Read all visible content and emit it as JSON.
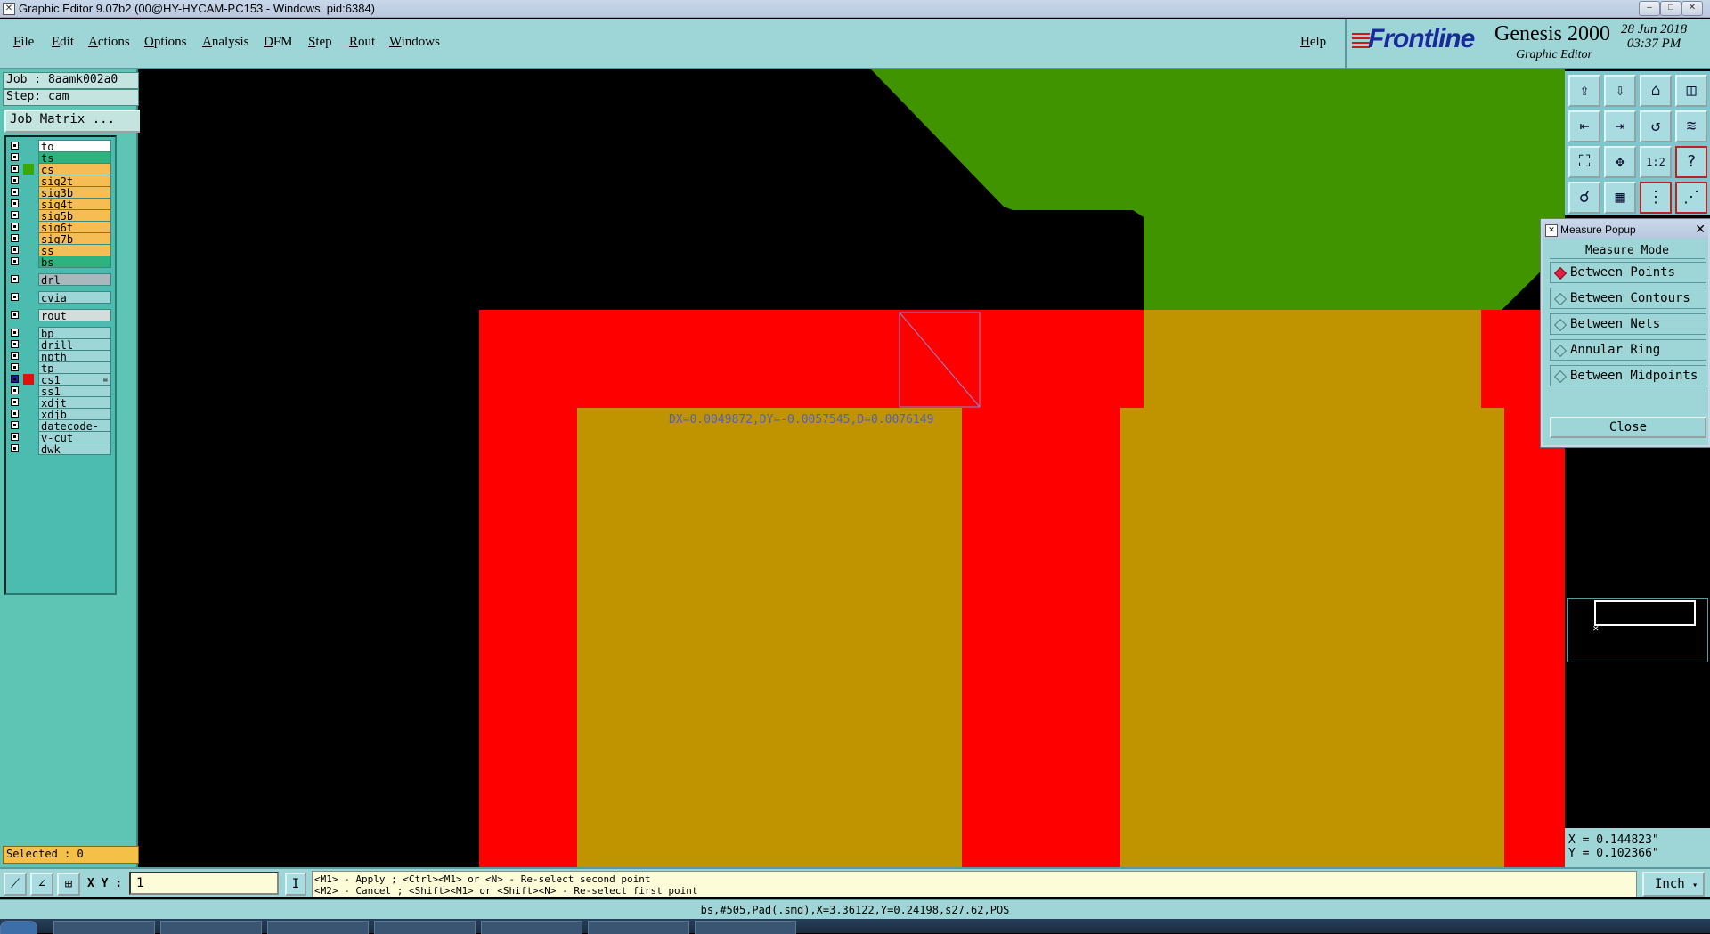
{
  "window": {
    "title": "Graphic Editor 9.07b2 (00@HY-HYCAM-PC153 - Windows, pid:6384)",
    "controls": [
      "–",
      "□",
      "✕"
    ]
  },
  "menu": [
    "File",
    "Edit",
    "Actions",
    "Options",
    "Analysis",
    "DFM",
    "Step",
    "Rout",
    "Windows"
  ],
  "help_label": "Help",
  "brand": {
    "logo_text": "Frontline",
    "product": "Genesis 2000",
    "subtitle": "Graphic Editor",
    "date": "28 Jun 2018",
    "time": "03:37 PM"
  },
  "job": {
    "job_line": "Job : 8aamk002a0",
    "step_line": "Step: cam",
    "matrix_button": "Job Matrix ..."
  },
  "layers": [
    {
      "name": "to",
      "color": "#ffffff",
      "swatch": "",
      "group": 0
    },
    {
      "name": "ts",
      "color": "#2fb37e",
      "swatch": "",
      "group": 0
    },
    {
      "name": "cs",
      "color": "#f7bd55",
      "swatch": "#3aa800",
      "group": 0
    },
    {
      "name": "sig2t",
      "color": "#f7bd55",
      "swatch": "",
      "group": 0
    },
    {
      "name": "sig3b",
      "color": "#f7bd55",
      "swatch": "",
      "group": 0
    },
    {
      "name": "sig4t",
      "color": "#f7bd55",
      "swatch": "",
      "group": 0
    },
    {
      "name": "sig5b",
      "color": "#f7bd55",
      "swatch": "",
      "group": 0
    },
    {
      "name": "sig6t",
      "color": "#f7bd55",
      "swatch": "",
      "group": 0
    },
    {
      "name": "sig7b",
      "color": "#f7bd55",
      "swatch": "",
      "group": 0
    },
    {
      "name": "ss",
      "color": "#f7bd55",
      "swatch": "",
      "group": 0
    },
    {
      "name": "bs",
      "color": "#2fb37e",
      "swatch": "",
      "group": 0
    },
    {
      "name": "drl",
      "color": "#a8b8bc",
      "swatch": "",
      "group": 1
    },
    {
      "name": "cvia",
      "color": "#9ed6d8",
      "swatch": "",
      "group": 2
    },
    {
      "name": "rout",
      "color": "#d4dcdc",
      "swatch": "",
      "group": 3
    },
    {
      "name": "bp",
      "color": "#9ed6d8",
      "swatch": "",
      "group": 4
    },
    {
      "name": "drill",
      "color": "#9ed6d8",
      "swatch": "",
      "group": 4
    },
    {
      "name": "npth",
      "color": "#9ed6d8",
      "swatch": "",
      "group": 4
    },
    {
      "name": "tp",
      "color": "#9ed6d8",
      "swatch": "",
      "group": 4
    },
    {
      "name": "cs1",
      "color": "#9ed6d8",
      "swatch": "#e01010",
      "group": 4,
      "active": true,
      "mark": "≡"
    },
    {
      "name": "ss1",
      "color": "#9ed6d8",
      "swatch": "",
      "group": 4
    },
    {
      "name": "xdjt",
      "color": "#9ed6d8",
      "swatch": "",
      "group": 4
    },
    {
      "name": "xdjb",
      "color": "#9ed6d8",
      "swatch": "",
      "group": 4
    },
    {
      "name": "datecode-cs",
      "color": "#9ed6d8",
      "swatch": "",
      "group": 4
    },
    {
      "name": "v-cut",
      "color": "#9ed6d8",
      "swatch": "",
      "group": 4
    },
    {
      "name": "dwk",
      "color": "#9ed6d8",
      "swatch": "",
      "group": 4
    }
  ],
  "selected": "Selected : 0",
  "measure": {
    "readout": "DX=0.0049872,DY=-0.0057545,D=0.0076149"
  },
  "measure_popup": {
    "title": "Measure Popup",
    "mode_label": "Measure Mode",
    "options": [
      {
        "label": "Between Points",
        "selected": true
      },
      {
        "label": "Between Contours",
        "selected": false
      },
      {
        "label": "Between Nets",
        "selected": false
      },
      {
        "label": "Annular Ring",
        "selected": false
      },
      {
        "label": "Between Midpoints",
        "selected": false
      }
    ],
    "close_label": "Close"
  },
  "toolbar_icons": [
    "import-icon",
    "export-icon",
    "home-icon",
    "split-view-icon",
    "pan-left-icon",
    "pan-right-icon",
    "undo-icon",
    "snap-icon",
    "zoom-fit-icon",
    "zoom-center-icon",
    "scale-one-to-two-icon",
    "help-icon",
    "measure-tool-icon",
    "grid-icon",
    "layer-stack-icon",
    "net-icon"
  ],
  "toolbar_glyphs": [
    "⇪",
    "⇩",
    "⌂",
    "◫",
    "⇤",
    "⇥",
    "↺",
    "≋",
    "⛶",
    "✥",
    "1:2",
    "?",
    "☌",
    "▦",
    "⋮",
    "⋰"
  ],
  "coords": {
    "x": "X = 0.144823\"",
    "y": "Y = 0.102366\""
  },
  "cmd": {
    "xy_label": "X Y :",
    "xy_value": "1",
    "i_button": "I",
    "hint1": "<M1> - Apply  ; <Ctrl><M1> or <N> - Re-select second point",
    "hint2": "<M2> - Cancel ; <Shift><M1> or <Shift><N> - Re-select first point",
    "unit": "Inch"
  },
  "status": "bs,#505,Pad(.smd),X=3.36122,Y=0.24198,s27.62,POS",
  "colors": {
    "cs_copper": "#3f9400",
    "cs1_red": "#ff0000",
    "overlap_gold": "#c09400",
    "ui_teal": "#9ed6d8"
  }
}
